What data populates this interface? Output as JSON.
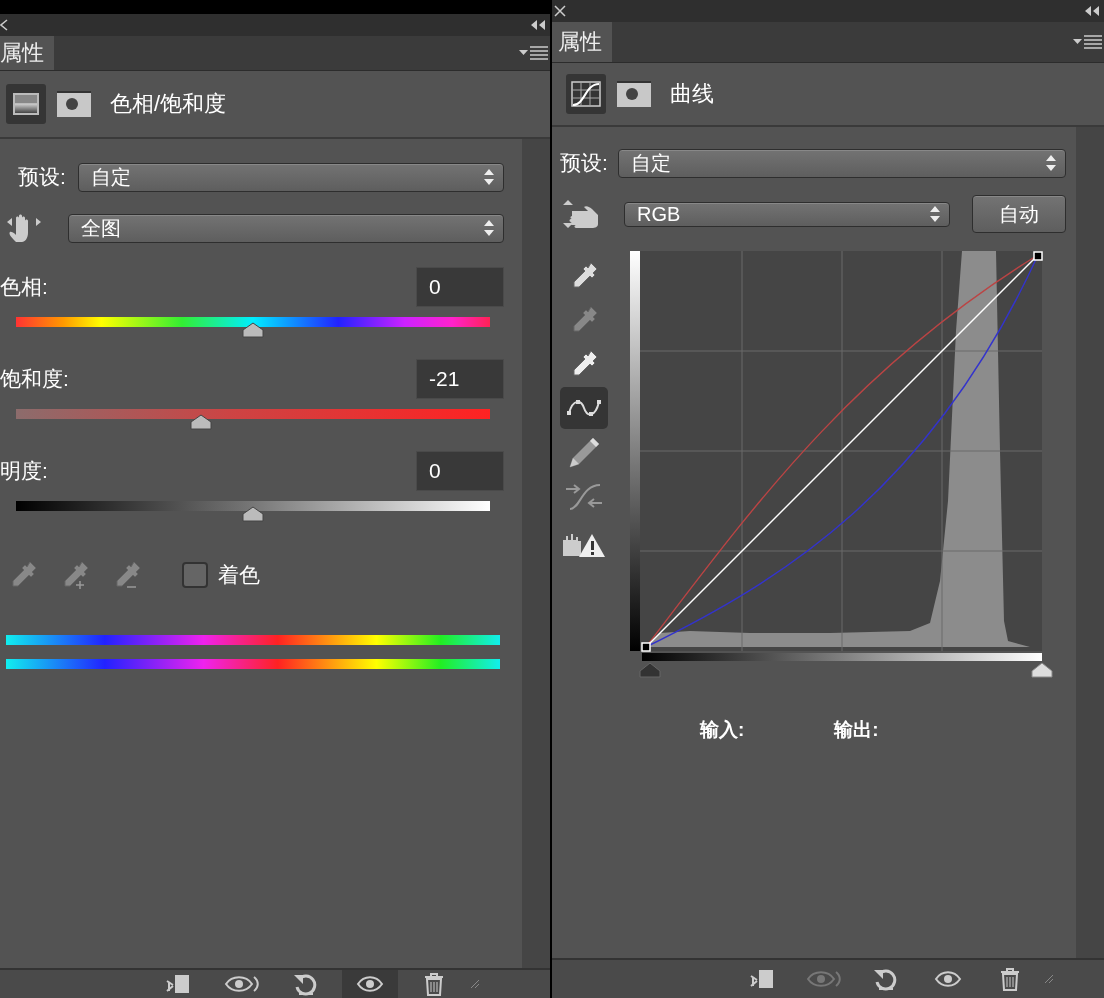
{
  "left_panel": {
    "tab": "属性",
    "adjustment_icons": [
      {
        "kind": "hue-saturation",
        "selected": true
      },
      {
        "kind": "mask",
        "selected": false
      }
    ],
    "title": "色相/饱和度",
    "preset": {
      "label": "预设:",
      "value": "自定"
    },
    "range": {
      "value": "全图"
    },
    "sliders": [
      {
        "kind": "hue",
        "label": "色相:",
        "value": "0",
        "level": 0.5
      },
      {
        "kind": "saturation",
        "label": "饱和度:",
        "value": "-21",
        "level": 0.39
      },
      {
        "kind": "lightness",
        "label": "明度:",
        "value": "0",
        "level": 0.5
      }
    ],
    "colorize": {
      "label": "着色",
      "checked": false
    },
    "footer_buttons": [
      {
        "kind": "clip",
        "selected": false
      },
      {
        "kind": "view-previous",
        "selected": false
      },
      {
        "kind": "reset",
        "selected": false
      },
      {
        "kind": "visibility",
        "selected": true
      },
      {
        "kind": "delete",
        "selected": false
      }
    ]
  },
  "right_panel": {
    "tab": "属性",
    "adjustment_icons": [
      {
        "kind": "curves",
        "selected": true
      },
      {
        "kind": "mask",
        "selected": false
      }
    ],
    "title": "曲线",
    "preset": {
      "label": "预设:",
      "value": "自定"
    },
    "channel": {
      "value": "RGB"
    },
    "auto_button": "自动",
    "tools": [
      {
        "kind": "eyedropper",
        "selected": false
      },
      {
        "kind": "eyedropper",
        "selected": false
      },
      {
        "kind": "eyedropper",
        "selected": false
      },
      {
        "kind": "point",
        "selected": true
      },
      {
        "kind": "pencil",
        "selected": false
      },
      {
        "kind": "smooth",
        "selected": false
      },
      {
        "kind": "clipping",
        "selected": false
      }
    ],
    "input_label": "输入:",
    "output_label": "输出:",
    "footer_buttons": [
      {
        "kind": "clip",
        "selected": false,
        "disabled": false
      },
      {
        "kind": "view-previous",
        "selected": false,
        "disabled": true
      },
      {
        "kind": "reset",
        "selected": false,
        "disabled": false
      },
      {
        "kind": "visibility",
        "selected": false,
        "disabled": false
      },
      {
        "kind": "delete",
        "selected": false,
        "disabled": false
      }
    ]
  }
}
